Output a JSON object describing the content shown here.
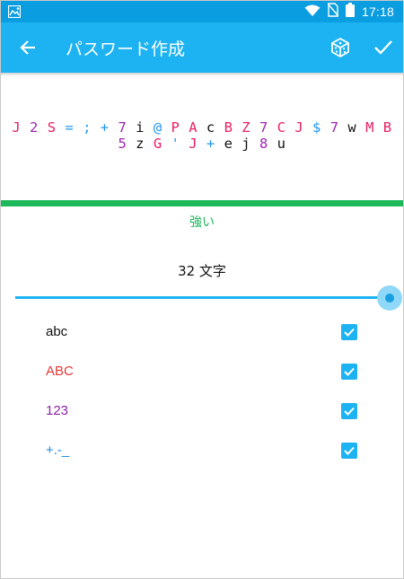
{
  "status_bar": {
    "time": "17:18"
  },
  "app_bar": {
    "title": "パスワード作成"
  },
  "password": {
    "chars": [
      {
        "c": "J",
        "color": "#e91e63"
      },
      {
        "c": "2",
        "color": "#9c27b0"
      },
      {
        "c": "S",
        "color": "#e91e63"
      },
      {
        "c": "=",
        "color": "#2196f3"
      },
      {
        "c": ";",
        "color": "#2196f3"
      },
      {
        "c": "+",
        "color": "#2196f3"
      },
      {
        "c": "7",
        "color": "#9c27b0"
      },
      {
        "c": "i",
        "color": "#111111"
      },
      {
        "c": "@",
        "color": "#2196f3"
      },
      {
        "c": "P",
        "color": "#e91e63"
      },
      {
        "c": "A",
        "color": "#e91e63"
      },
      {
        "c": "c",
        "color": "#111111"
      },
      {
        "c": "B",
        "color": "#e91e63"
      },
      {
        "c": "Z",
        "color": "#e91e63"
      },
      {
        "c": "7",
        "color": "#9c27b0"
      },
      {
        "c": "C",
        "color": "#e91e63"
      },
      {
        "c": "J",
        "color": "#e91e63"
      },
      {
        "c": "$",
        "color": "#2196f3"
      },
      {
        "c": "7",
        "color": "#9c27b0"
      },
      {
        "c": "w",
        "color": "#111111"
      },
      {
        "c": "M",
        "color": "#e91e63"
      },
      {
        "c": "B",
        "color": "#e91e63"
      },
      {
        "c": "5",
        "color": "#9c27b0"
      },
      {
        "c": "z",
        "color": "#111111"
      },
      {
        "c": "G",
        "color": "#e91e63"
      },
      {
        "c": "'",
        "color": "#2196f3"
      },
      {
        "c": "J",
        "color": "#e91e63"
      },
      {
        "c": "+",
        "color": "#2196f3"
      },
      {
        "c": "e",
        "color": "#111111"
      },
      {
        "c": "j",
        "color": "#111111"
      },
      {
        "c": "8",
        "color": "#9c27b0"
      },
      {
        "c": "u",
        "color": "#111111"
      }
    ]
  },
  "strength": {
    "label": "強い",
    "color": "#1cb85a"
  },
  "length": {
    "label": "32 文字",
    "value": 32,
    "fraction": 1.0
  },
  "options": [
    {
      "label": "abc",
      "color": "#111111",
      "checked": true
    },
    {
      "label": "ABC",
      "color": "#e53935",
      "checked": true
    },
    {
      "label": "123",
      "color": "#8e24aa",
      "checked": true
    },
    {
      "label": "+.-_",
      "color": "#1e88e5",
      "checked": true
    }
  ],
  "icons": {
    "back": "arrow-left-icon",
    "generate": "dice-icon",
    "confirm": "check-icon"
  },
  "colors": {
    "accent": "#1db3f2",
    "status_bar": "#0a9ee0"
  }
}
